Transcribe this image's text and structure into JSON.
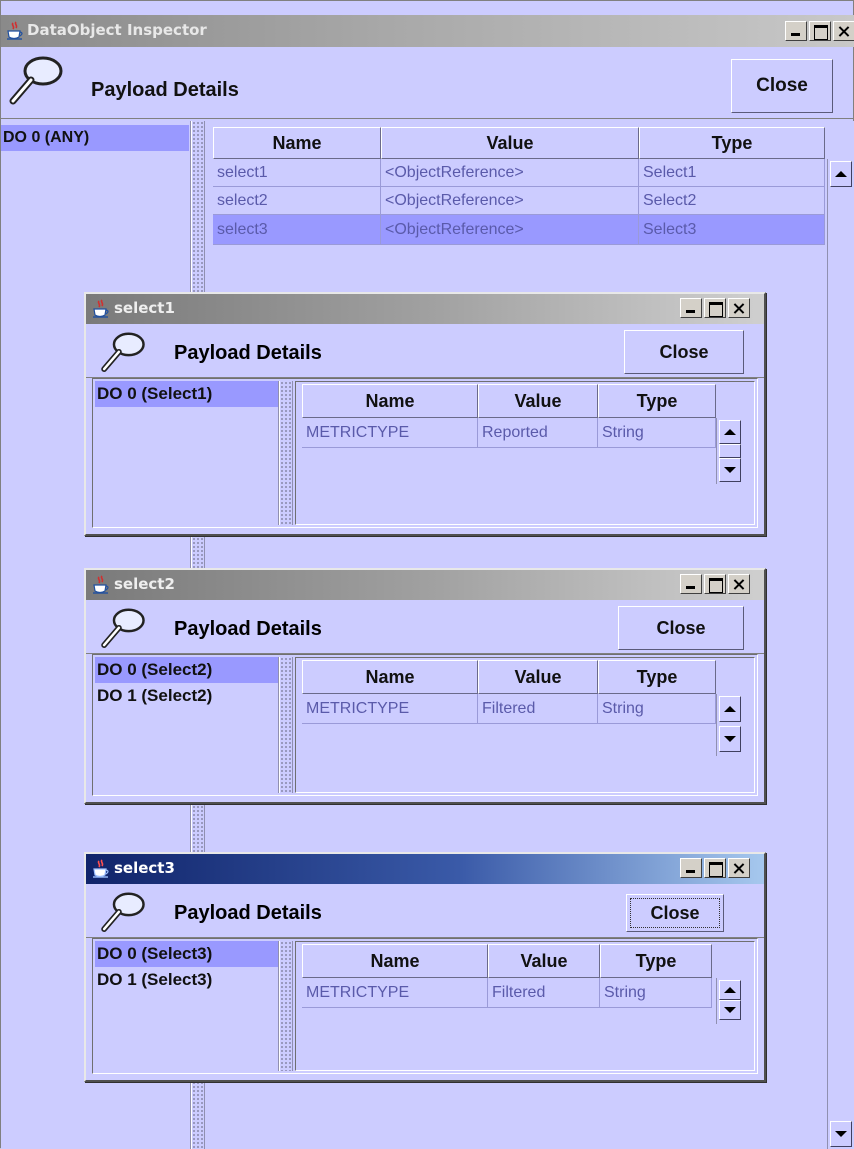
{
  "main": {
    "title": "DataObject Inspector",
    "header_title": "Payload Details",
    "close_label": "Close",
    "do_items": [
      "DO 0 (ANY)"
    ],
    "columns": [
      "Name",
      "Value",
      "Type"
    ],
    "rows": [
      {
        "name": "select1",
        "value": "<ObjectReference>",
        "type": "Select1"
      },
      {
        "name": "select2",
        "value": "<ObjectReference>",
        "type": "Select2"
      },
      {
        "name": "select3",
        "value": "<ObjectReference>",
        "type": "Select3"
      }
    ],
    "selected_row": 2
  },
  "frames": [
    {
      "title": "select1",
      "active": false,
      "header_title": "Payload Details",
      "close_label": "Close",
      "do_items": [
        "DO 0 (Select1)"
      ],
      "columns": [
        "Name",
        "Value",
        "Type"
      ],
      "rows": [
        {
          "name": "METRICTYPE",
          "value": "Reported",
          "type": "String"
        }
      ]
    },
    {
      "title": "select2",
      "active": false,
      "header_title": "Payload Details",
      "close_label": "Close",
      "do_items": [
        "DO 0 (Select2)",
        "DO 1 (Select2)"
      ],
      "columns": [
        "Name",
        "Value",
        "Type"
      ],
      "rows": [
        {
          "name": "METRICTYPE",
          "value": "Filtered",
          "type": "String"
        }
      ]
    },
    {
      "title": "select3",
      "active": true,
      "header_title": "Payload Details",
      "close_label": "Close",
      "do_items": [
        "DO 0 (Select3)",
        "DO 1 (Select3)"
      ],
      "columns": [
        "Name",
        "Value",
        "Type"
      ],
      "rows": [
        {
          "name": "METRICTYPE",
          "value": "Filtered",
          "type": "String"
        }
      ]
    }
  ],
  "icons": {
    "title_icon": "java-cup-icon",
    "header_icon": "magnifying-glass-icon"
  },
  "colors": {
    "panel_bg": "#ccccff",
    "selection": "#9999ff",
    "cell_text": "#5a5aaa",
    "active_title": "#10246a"
  }
}
